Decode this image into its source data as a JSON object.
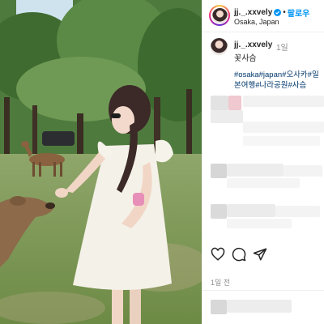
{
  "post": {
    "username": "jj._.xxvely",
    "follow_label": "팔로우",
    "separator": "•",
    "location": "Osaka, Japan"
  },
  "caption": {
    "username": "jj._.xxvely",
    "time": "1일",
    "text": "꽃사슴",
    "hashtags": "#osaka#japan#오사카#일본여행#나라공원#사슴"
  },
  "footer": {
    "time_ago": "1일 전"
  },
  "icons": {
    "like": "heart-icon",
    "comment": "comment-icon",
    "share": "send-icon",
    "verified": "verified-badge-icon"
  },
  "colors": {
    "link": "#0095f6",
    "hashtag": "#00376b",
    "muted": "#8e8e8e"
  }
}
